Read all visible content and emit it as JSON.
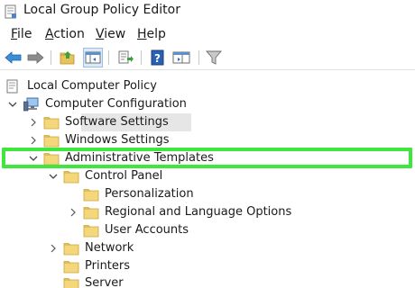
{
  "window": {
    "title": "Local Group Policy Editor"
  },
  "menu": {
    "file": {
      "ul": "F",
      "rest": "ile"
    },
    "action": {
      "ul": "A",
      "rest": "ction"
    },
    "view": {
      "ul": "V",
      "rest": "iew"
    },
    "help": {
      "ul": "H",
      "rest": "elp"
    }
  },
  "toolbar": {
    "buttons": [
      "back-arrow-icon",
      "forward-arrow-icon",
      "up-folder-icon",
      "show-hide-tree-icon",
      "export-list-icon",
      "help-icon",
      "properties-icon",
      "filter-icon"
    ]
  },
  "tree": {
    "root": "Local Computer Policy",
    "computer_config": "Computer Configuration",
    "software_settings": "Software Settings",
    "windows_settings": "Windows Settings",
    "admin_templates": "Administrative Templates",
    "control_panel": "Control Panel",
    "personalization": "Personalization",
    "regional": "Regional and Language Options",
    "user_accounts": "User Accounts",
    "network": "Network",
    "printers": "Printers",
    "server": "Server"
  },
  "colors": {
    "highlight": "#3ee63e",
    "selected": "#e6e6e6",
    "folder": "#f5d77b"
  }
}
